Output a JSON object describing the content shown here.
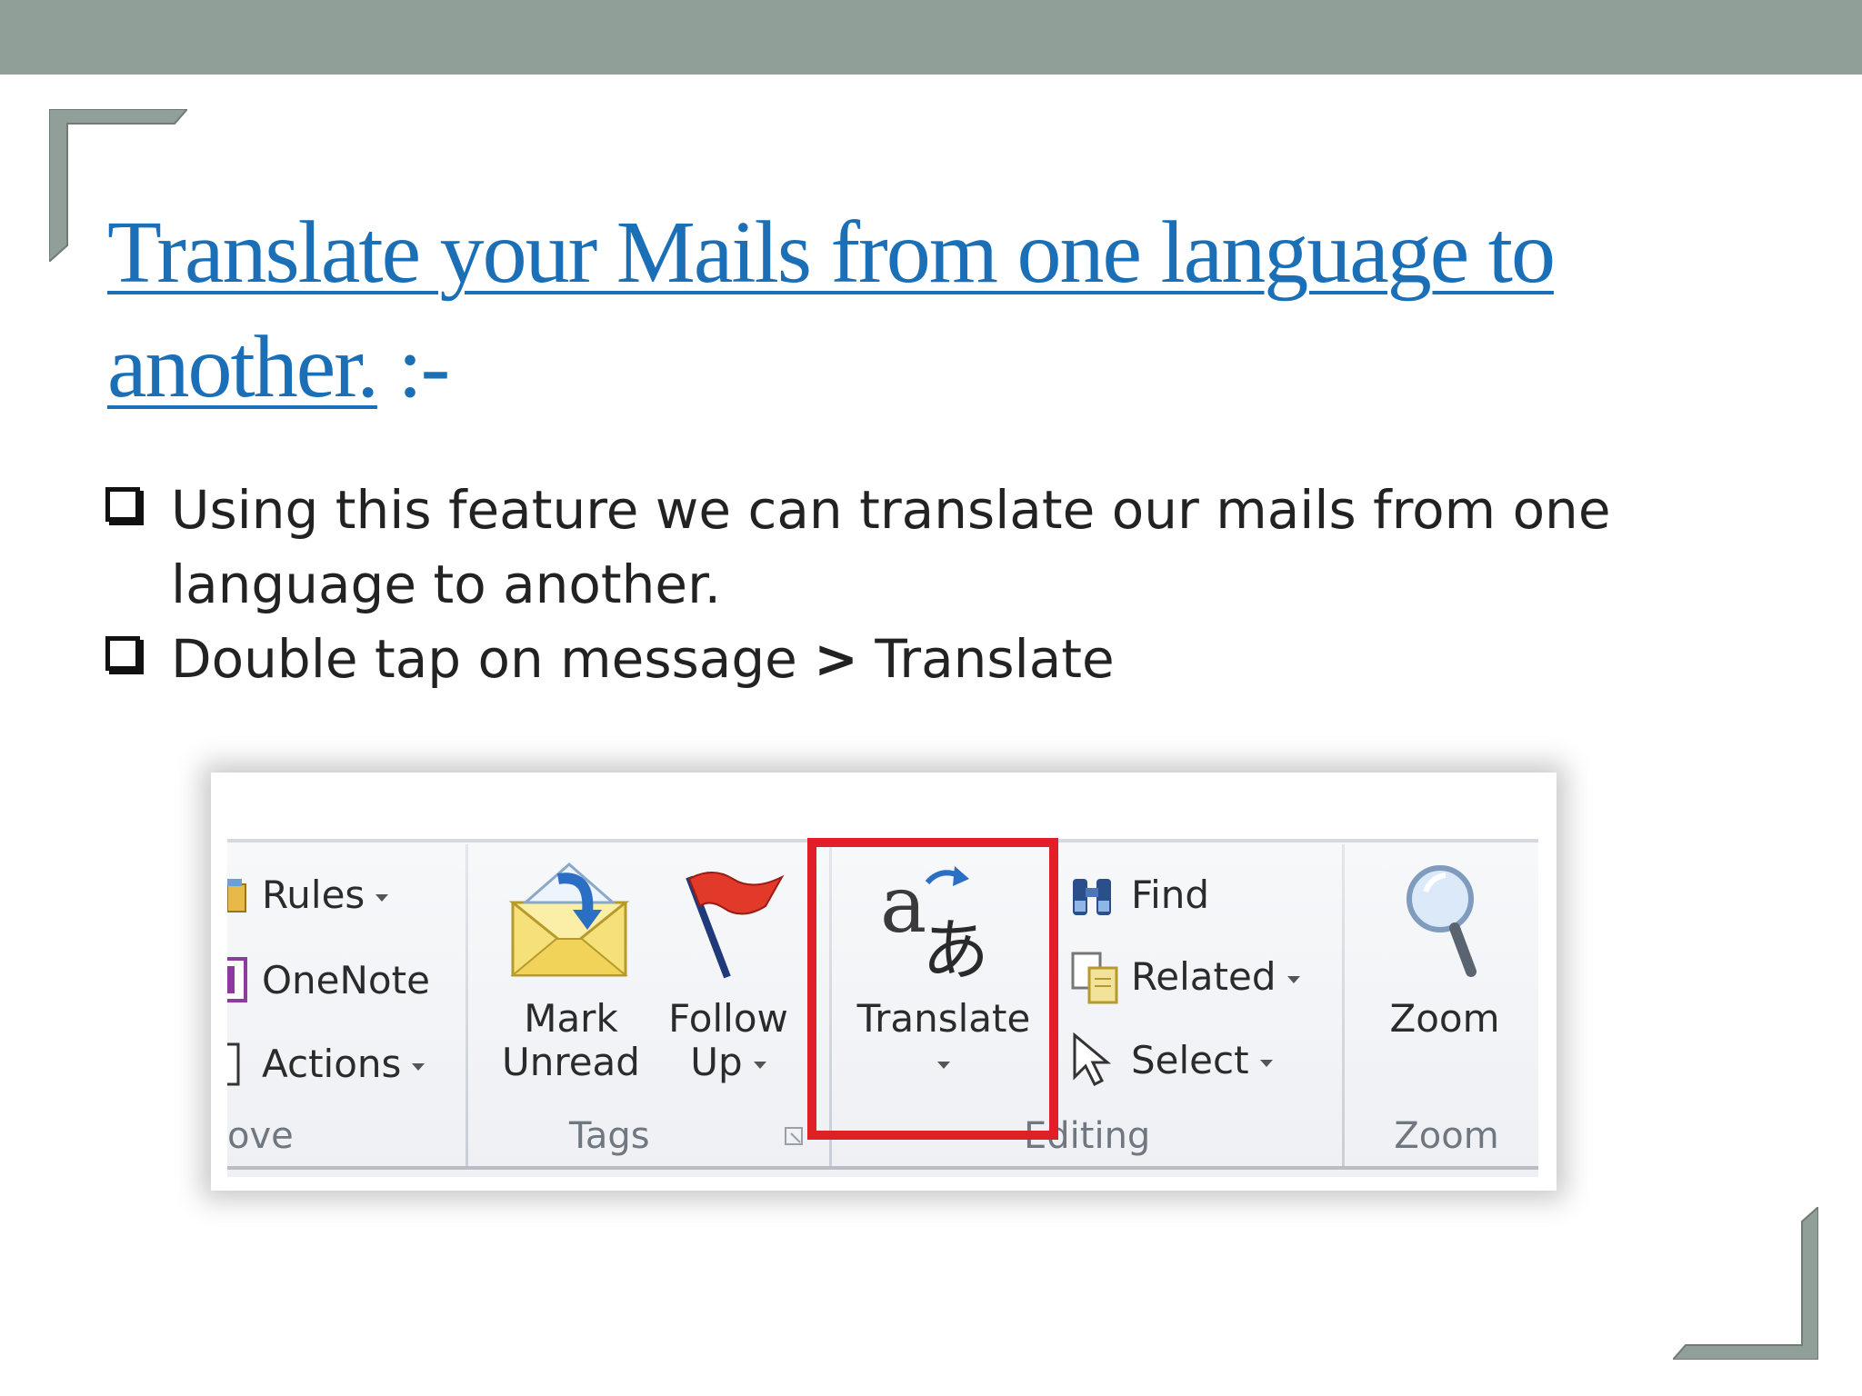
{
  "slide": {
    "title_link": "Translate your Mails from one language to another.",
    "title_suffix": " :-",
    "bullets": [
      {
        "text": "Using this feature we can translate our mails from one language to another."
      },
      {
        "text_before": "Double tap on message ",
        "gt": ">",
        "text_after": " Translate"
      }
    ]
  },
  "ribbon": {
    "move_group": {
      "rules": "Rules",
      "onenote": "OneNote",
      "actions": "Actions",
      "label": "ove"
    },
    "tags_group": {
      "mark_unread_line1": "Mark",
      "mark_unread_line2": "Unread",
      "follow_up_line1": "Follow",
      "follow_up_line2": "Up",
      "label": "Tags"
    },
    "translate": {
      "label": "Translate"
    },
    "editing_group": {
      "find": "Find",
      "related": "Related",
      "select": "Select",
      "label": "Editing"
    },
    "zoom_group": {
      "zoom": "Zoom",
      "label": "Zoom"
    }
  },
  "colors": {
    "top_band": "#909f97",
    "title": "#1a6fb7",
    "highlight": "#e01f26"
  }
}
